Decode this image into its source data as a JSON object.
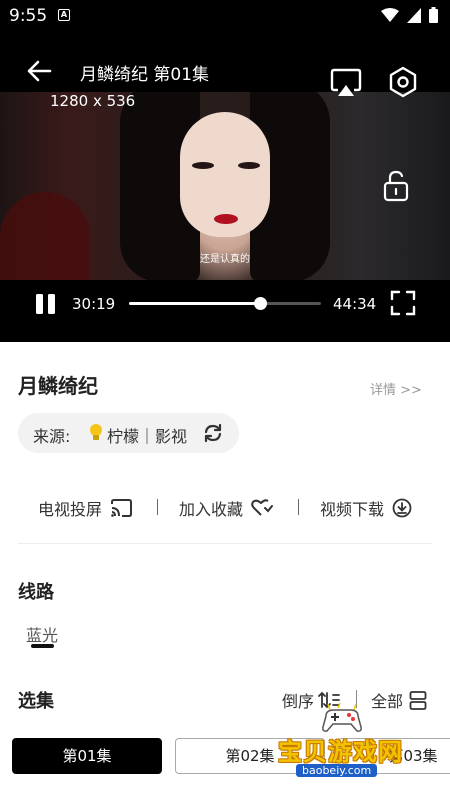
{
  "status_bar": {
    "time": "9:55",
    "notification_glyph": "A"
  },
  "player": {
    "title": "月鳞绮纪 第01集",
    "resolution": "1280 x 536",
    "subtitle": "还是认真的",
    "current_time": "30:19",
    "total_time": "44:34",
    "progress": 0.68
  },
  "info": {
    "show_title": "月鳞绮纪",
    "details_link": "详情 >>",
    "source_label": "来源:",
    "source_name": "柠檬｜影视"
  },
  "actions": {
    "tv_cast": "电视投屏",
    "add_favorite": "加入收藏",
    "download": "视频下载"
  },
  "routes": {
    "title": "线路",
    "items": [
      {
        "label": "蓝光",
        "selected": true
      }
    ]
  },
  "episodes": {
    "title": "选集",
    "order_label": "倒序",
    "all_label": "全部",
    "items": [
      "第01集",
      "第02集",
      "第03集"
    ],
    "selected_index": 0
  },
  "watermark": {
    "text": "宝贝游戏网",
    "url": "baobeiy.com"
  },
  "colors": {
    "accent": "#000000",
    "watermark_yellow": "#f2c400",
    "watermark_blue": "#1d5fc7"
  }
}
